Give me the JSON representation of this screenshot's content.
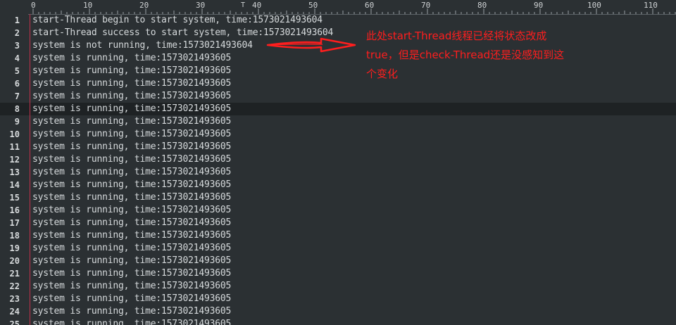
{
  "ruler": {
    "marks": [
      "0",
      "10",
      "20",
      "30",
      "40",
      "50",
      "60",
      "70",
      "80",
      "90",
      "100",
      "110"
    ],
    "caret_symbol": "T"
  },
  "lines": [
    {
      "number": "1",
      "text": "start-Thread begin to start system, time:1573021493604"
    },
    {
      "number": "2",
      "text": "start-Thread success to start system, time:1573021493604"
    },
    {
      "number": "3",
      "text": "system is not running, time:1573021493604"
    },
    {
      "number": "4",
      "text": "system is running, time:1573021493605"
    },
    {
      "number": "5",
      "text": "system is running, time:1573021493605"
    },
    {
      "number": "6",
      "text": "system is running, time:1573021493605"
    },
    {
      "number": "7",
      "text": "system is running, time:1573021493605"
    },
    {
      "number": "8",
      "text": "system is running, time:1573021493605"
    },
    {
      "number": "9",
      "text": "system is running, time:1573021493605"
    },
    {
      "number": "10",
      "text": "system is running, time:1573021493605"
    },
    {
      "number": "11",
      "text": "system is running, time:1573021493605"
    },
    {
      "number": "12",
      "text": "system is running, time:1573021493605"
    },
    {
      "number": "13",
      "text": "system is running, time:1573021493605"
    },
    {
      "number": "14",
      "text": "system is running, time:1573021493605"
    },
    {
      "number": "15",
      "text": "system is running, time:1573021493605"
    },
    {
      "number": "16",
      "text": "system is running, time:1573021493605"
    },
    {
      "number": "17",
      "text": "system is running, time:1573021493605"
    },
    {
      "number": "18",
      "text": "system is running, time:1573021493605"
    },
    {
      "number": "19",
      "text": "system is running, time:1573021493605"
    },
    {
      "number": "20",
      "text": "system is running, time:1573021493605"
    },
    {
      "number": "21",
      "text": "system is running, time:1573021493605"
    },
    {
      "number": "22",
      "text": "system is running, time:1573021493605"
    },
    {
      "number": "23",
      "text": "system is running, time:1573021493605"
    },
    {
      "number": "24",
      "text": "system is running, time:1573021493605"
    },
    {
      "number": "25",
      "text": "system is running, time:1573021493605"
    }
  ],
  "current_line": 8,
  "annotation": {
    "line1": "此处start-Thread线程已经将状态改成",
    "line2": "true，但是check-Thread还是没感知到这",
    "line3": "个变化"
  },
  "colors": {
    "background": "#2b3033",
    "current_line": "#1e2224",
    "text": "#d6dadc",
    "margin_line": "#c0304a",
    "annotation": "#ff1e1e"
  }
}
